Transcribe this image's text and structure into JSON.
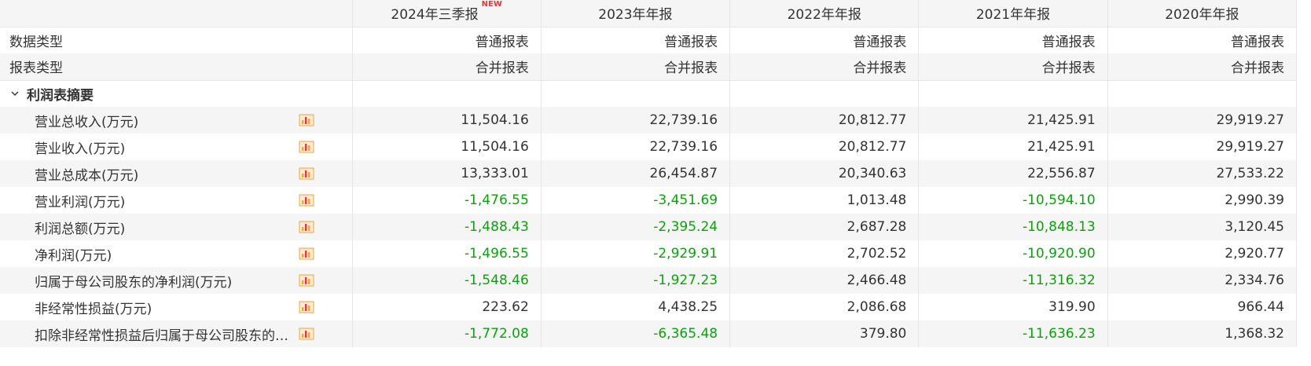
{
  "header": {
    "periods": [
      "2024年三季报",
      "2023年年报",
      "2022年年报",
      "2021年年报",
      "2020年年报"
    ],
    "new_badge": "NEW"
  },
  "meta_rows": [
    {
      "label": "数据类型",
      "values": [
        "普通报表",
        "普通报表",
        "普通报表",
        "普通报表",
        "普通报表"
      ]
    },
    {
      "label": "报表类型",
      "values": [
        "合并报表",
        "合并报表",
        "合并报表",
        "合并报表",
        "合并报表"
      ]
    }
  ],
  "section": {
    "title": "利润表摘要",
    "icon": "chevron-down-icon"
  },
  "rows": [
    {
      "label": "营业总收入(万元)",
      "values": [
        "11,504.16",
        "22,739.16",
        "20,812.77",
        "21,425.91",
        "29,919.27"
      ]
    },
    {
      "label": "营业收入(万元)",
      "values": [
        "11,504.16",
        "22,739.16",
        "20,812.77",
        "21,425.91",
        "29,919.27"
      ]
    },
    {
      "label": "营业总成本(万元)",
      "values": [
        "13,333.01",
        "26,454.87",
        "20,340.63",
        "22,556.87",
        "27,533.22"
      ]
    },
    {
      "label": "营业利润(万元)",
      "values": [
        "-1,476.55",
        "-3,451.69",
        "1,013.48",
        "-10,594.10",
        "2,990.39"
      ]
    },
    {
      "label": "利润总额(万元)",
      "values": [
        "-1,488.43",
        "-2,395.24",
        "2,687.28",
        "-10,848.13",
        "3,120.45"
      ]
    },
    {
      "label": "净利润(万元)",
      "values": [
        "-1,496.55",
        "-2,929.91",
        "2,702.52",
        "-10,920.90",
        "2,920.77"
      ]
    },
    {
      "label": "归属于母公司股东的净利润(万元)",
      "values": [
        "-1,548.46",
        "-1,927.23",
        "2,466.48",
        "-11,316.32",
        "2,334.76"
      ]
    },
    {
      "label": "非经常性损益(万元)",
      "values": [
        "223.62",
        "4,438.25",
        "2,086.68",
        "319.90",
        "966.44"
      ]
    },
    {
      "label": "扣除非经常性损益后归属于母公司股东的…",
      "values": [
        "-1,772.08",
        "-6,365.48",
        "379.80",
        "-11,636.23",
        "1,368.32"
      ]
    }
  ],
  "colors": {
    "negative": "#139c13",
    "new_badge": "#e4393c",
    "chart_icon_orange": "#f4a23a",
    "chart_icon_red": "#e4393c",
    "shade": "#f5f5f5"
  },
  "row_icon": "bar-chart-icon"
}
